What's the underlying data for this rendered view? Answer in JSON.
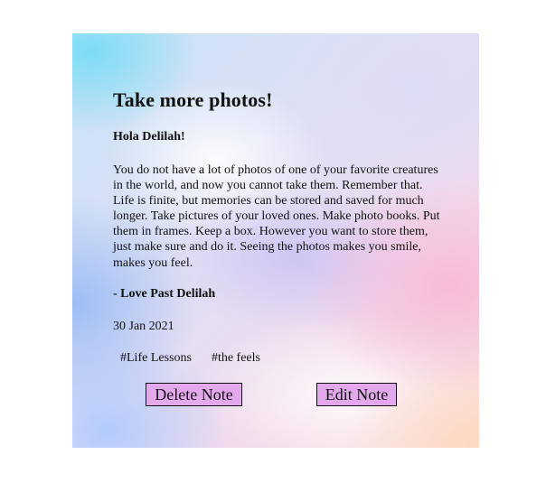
{
  "note": {
    "title": "Take more photos!",
    "greeting": "Hola Delilah!",
    "body": "You do not have a lot of photos of one of your favorite creatures in the world, and now you cannot take them. Remember that. Life is finite, but memories can be stored and saved for much longer. Take pictures of your loved ones. Make photo books. Put them in frames. Keep a box. However you want to store them, just make sure and do it. Seeing the photos makes you smile, makes you feel.",
    "signoff": "- Love Past Delilah",
    "date": "30 Jan 2021",
    "tags": [
      "#Life Lessons",
      "#the feels"
    ]
  },
  "actions": {
    "delete_label": "Delete Note",
    "edit_label": "Edit Note"
  },
  "colors": {
    "button_bg": "#e4a9ec",
    "text": "#111111"
  }
}
